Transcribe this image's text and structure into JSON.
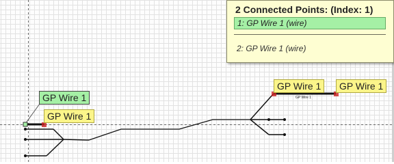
{
  "popup": {
    "title": "2 Connected Points:  (Index: 1)",
    "items": [
      {
        "label": "1:  GP Wire 1 (wire)",
        "selected": true
      },
      {
        "label": "2:  GP Wire 1 (wire)",
        "selected": false
      }
    ]
  },
  "labels": {
    "left_green": "GP Wire 1",
    "left_yellow": "GP Wire 1",
    "right_yellow_a": "GP Wire 1",
    "right_yellow_b": "GP Wire 1",
    "wire_caption": "GP Wire 1"
  },
  "colors": {
    "tag_yellow": "#fbf58a",
    "tag_green": "#a5f0a5",
    "popup_bg": "#fefed2",
    "endpoint_red": "#cc2222"
  }
}
